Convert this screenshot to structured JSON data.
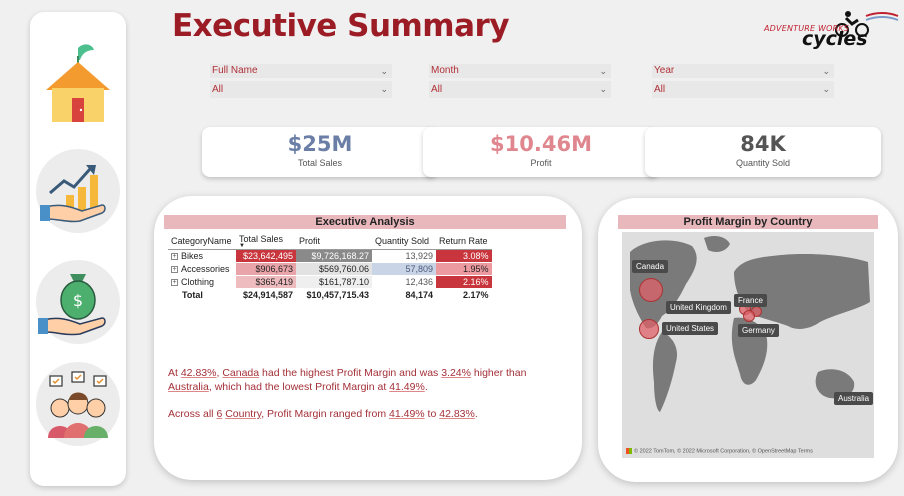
{
  "page": {
    "title": "Executive Summary"
  },
  "logo": {
    "line1": "ADVENTURE WORKS",
    "line2": "cycles"
  },
  "nav": [
    {
      "name": "home-icon"
    },
    {
      "name": "growth-chart-icon"
    },
    {
      "name": "money-bag-hand-icon"
    },
    {
      "name": "team-icon"
    }
  ],
  "filters": [
    {
      "label": "Full Name",
      "value": "All"
    },
    {
      "label": "Month",
      "value": "All"
    },
    {
      "label": "Year",
      "value": "All"
    }
  ],
  "kpis": [
    {
      "value": "$25M",
      "label": "Total Sales",
      "color": "#6b7fa6"
    },
    {
      "value": "$10.46M",
      "label": "Profit",
      "color": "#e0868e"
    },
    {
      "value": "84K",
      "label": "Quantity Sold",
      "color": "#555555"
    }
  ],
  "analysis": {
    "title": "Executive Analysis",
    "headers": [
      "CategoryName",
      "Total Sales",
      "Profit",
      "Quantity Sold",
      "Return Rate"
    ],
    "rows": [
      {
        "category": "Bikes",
        "sales": "$23,642,495",
        "profit": "$9,726,168.27",
        "qty": "13,929",
        "rate": "3.08%"
      },
      {
        "category": "Accessories",
        "sales": "$906,673",
        "profit": "$569,760.06",
        "qty": "57,809",
        "rate": "1.95%"
      },
      {
        "category": "Clothing",
        "sales": "$365,419",
        "profit": "$161,787.10",
        "qty": "12,436",
        "rate": "2.16%"
      }
    ],
    "total": {
      "category": "Total",
      "sales": "$24,914,587",
      "profit": "$10,457,715.43",
      "qty": "84,174",
      "rate": "2.17%"
    }
  },
  "narrative": {
    "p1": {
      "t1": "At ",
      "h1": "42.83%",
      "t2": ", ",
      "h2": "Canada",
      "t3": " had the highest Profit Margin and was ",
      "h3": "3.24%",
      "t4": " higher than ",
      "h4": "Australia",
      "t5": ", which had the lowest Profit Margin at ",
      "h5": "41.49%",
      "t6": "."
    },
    "p2": {
      "t1": "Across all ",
      "h1": "6",
      "t2": " ",
      "h2": "Country",
      "t3": ", Profit Margin ranged from ",
      "h3": "41.49%",
      "t4": " to ",
      "h4": "42.83%",
      "t5": "."
    }
  },
  "map": {
    "title": "Profit Margin by Country",
    "labels": [
      "Canada",
      "United Kingdom",
      "France",
      "United States",
      "Germany",
      "Australia"
    ],
    "attribution": "© 2022 TomTom, © 2022 Microsoft Corporation, © OpenStreetMap  Terms",
    "bubble_color": "#e0606a"
  }
}
